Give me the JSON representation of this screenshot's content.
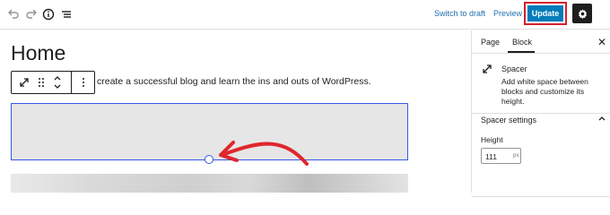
{
  "toolbar": {
    "switch_to_draft": "Switch to draft",
    "preview": "Preview",
    "update": "Update",
    "icons": [
      "undo-icon",
      "redo-icon",
      "info-icon",
      "list-view-icon",
      "gear-icon"
    ]
  },
  "editor": {
    "page_title": "Home",
    "paragraph": "create a successful blog and learn the ins and outs of WordPress.",
    "block_toolbar_icons": [
      "resize-icon",
      "drag-handle-icon",
      "move-up-down-icon",
      "more-options-icon"
    ]
  },
  "sidebar": {
    "tabs": [
      "Page",
      "Block"
    ],
    "active_tab": "Block",
    "block_name": "Spacer",
    "block_description": "Add white space between blocks and customize its height.",
    "panel_title": "Spacer settings",
    "height_label": "Height",
    "height_value": "111",
    "height_unit": "px"
  },
  "colors": {
    "primary": "#007cba",
    "highlight_border": "#d6202d",
    "selection": "#3858e9",
    "annotation_arrow": "#e0262d"
  }
}
